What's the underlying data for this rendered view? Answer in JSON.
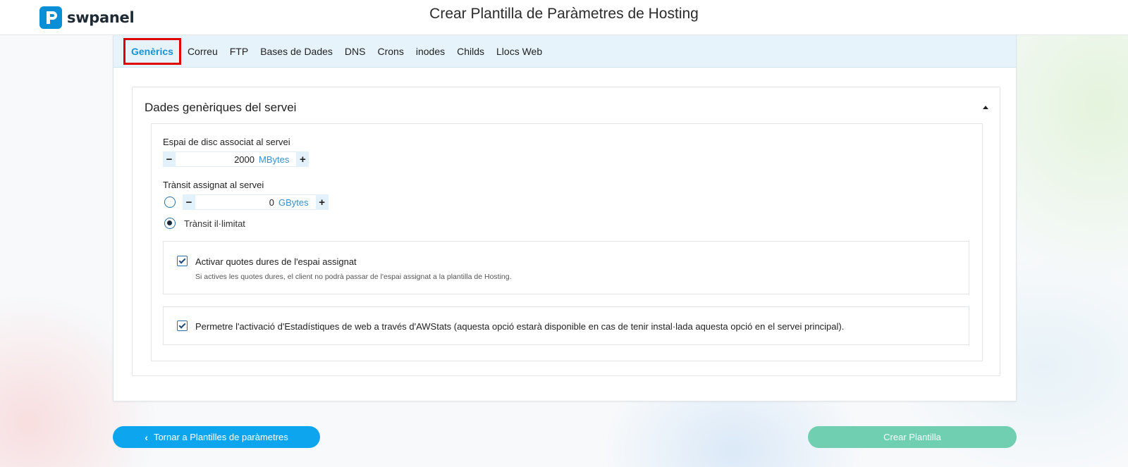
{
  "brand": {
    "name": "swpanel",
    "color": "#0a8fd6"
  },
  "page": {
    "title": "Crear Plantilla de Paràmetres de Hosting"
  },
  "tabs": [
    {
      "label": "Genèrics",
      "active": true
    },
    {
      "label": "Correu"
    },
    {
      "label": "FTP"
    },
    {
      "label": "Bases de Dades"
    },
    {
      "label": "DNS"
    },
    {
      "label": "Crons"
    },
    {
      "label": "inodes"
    },
    {
      "label": "Childs"
    },
    {
      "label": "Llocs Web"
    }
  ],
  "section": {
    "title": "Dades genèriques del servei",
    "disk": {
      "label": "Espai de disc associat al servei",
      "value": "2000",
      "unit": "MBytes",
      "minus": "−",
      "plus": "+"
    },
    "transit": {
      "label": "Trànsit assignat al servei",
      "value": "0",
      "unit": "GBytes",
      "minus": "−",
      "plus": "+",
      "unlimited_label": "Trànsit il·limitat",
      "selected": "unlimited"
    },
    "quota": {
      "title": "Activar quotes dures de l'espai assignat",
      "description": "Si actives les quotes dures, el client no podrà passar de l'espai assignat a la plantilla de Hosting.",
      "checked": true
    },
    "awstats": {
      "title": "Permetre l'activació d'Estadístiques de web a través d'AWStats (aquesta opció estarà disponible en cas de tenir instal·lada aquesta opció en el servei principal).",
      "checked": true
    }
  },
  "buttons": {
    "back": {
      "chevron": "‹",
      "label": "Tornar a Plantilles de paràmetres"
    },
    "create": {
      "label": "Crear Plantilla"
    }
  }
}
